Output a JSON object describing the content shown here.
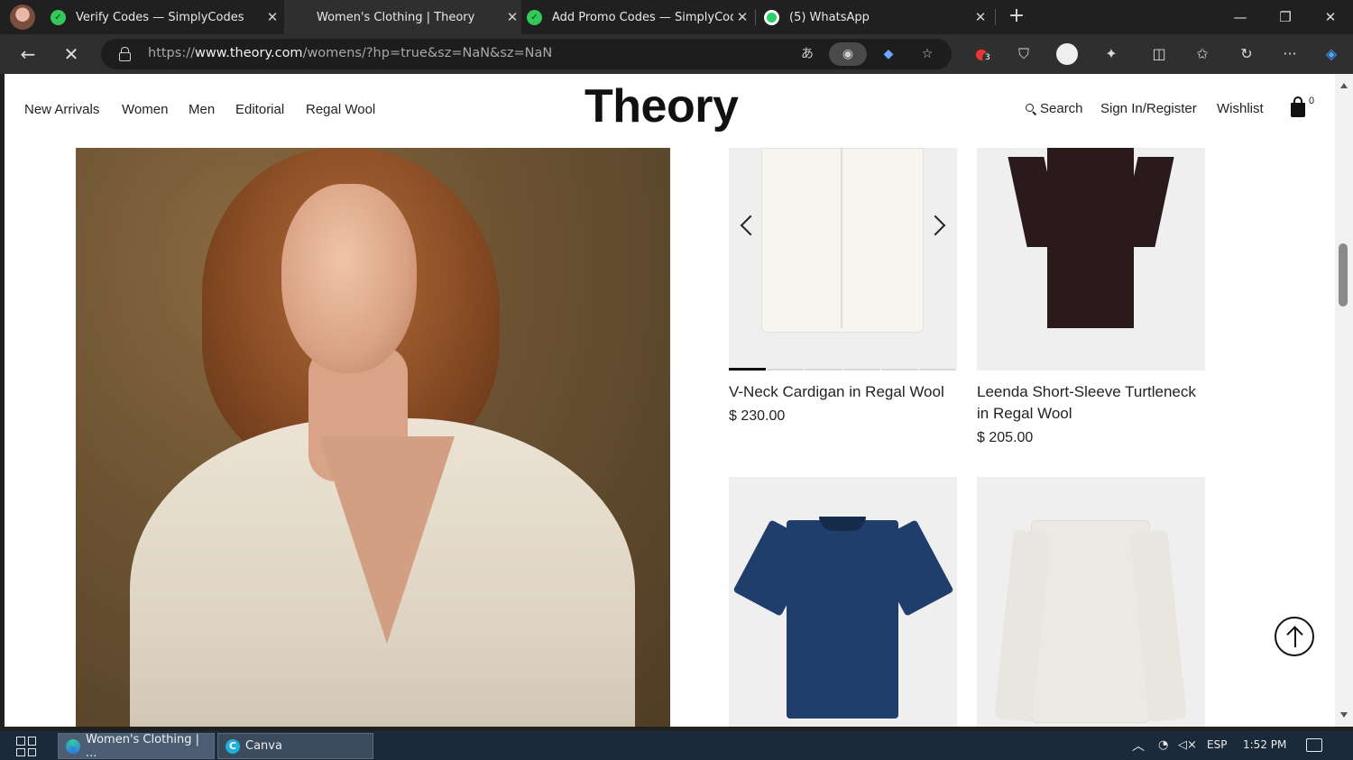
{
  "browser": {
    "tabs": [
      {
        "title": "Verify Codes — SimplyCodes",
        "close": "✕"
      },
      {
        "title": "Women's Clothing | Theory",
        "close": "✕"
      },
      {
        "title": "Add Promo Codes — SimplyCodes",
        "close": "✕"
      },
      {
        "title": "(5) WhatsApp",
        "close": "✕"
      }
    ],
    "new_tab": "+",
    "window": {
      "minimize": "—",
      "restore": "❐",
      "close": "✕"
    },
    "url_prefix": "https://",
    "url_host": "www.theory.com",
    "url_path": "/womens/?hp=true&sz=NaN&sz=NaN",
    "extension_badge": "3"
  },
  "site": {
    "nav": [
      "New Arrivals",
      "Women",
      "Men",
      "Editorial",
      "Regal Wool"
    ],
    "logo": "Theory",
    "search": "Search",
    "sign_in": "Sign In/Register",
    "wishlist": "Wishlist",
    "bag_count": "0"
  },
  "products": [
    {
      "name": "V-Neck Cardigan in Regal Wool",
      "price": "$ 230.00",
      "color": "#f4f2ec"
    },
    {
      "name": "Leenda Short-Sleeve Turtleneck in Regal Wool",
      "price": "$ 205.00",
      "color": "#2b1a1b"
    },
    {
      "name": "",
      "price": "",
      "color": "#1f3e6b"
    },
    {
      "name": "",
      "price": "",
      "color": "#ede9e4"
    }
  ],
  "carousel": {
    "dots": 6,
    "active_dot": 1
  },
  "taskbar": {
    "items": [
      "Women's Clothing | ...",
      "Canva"
    ],
    "lang": "ESP",
    "time": "1:52 PM"
  },
  "colors": {
    "accent_whatsapp": "#25d366",
    "accent_simplycodes": "#34c759",
    "taskbar_bg": "#1b2a3a"
  }
}
